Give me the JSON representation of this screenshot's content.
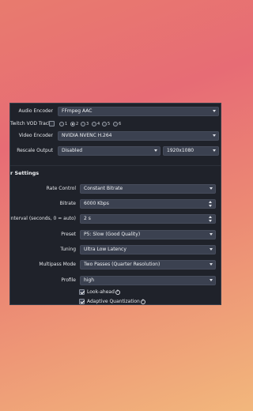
{
  "top_settings": {
    "audio_encoder": {
      "label": "Audio Encoder",
      "value": "FFmpeg AAC"
    },
    "twitch_vod_track": {
      "label": "Twitch VOD Track",
      "tracks": [
        "1",
        "2",
        "3",
        "4",
        "5",
        "6"
      ],
      "selected": "2"
    },
    "video_encoder": {
      "label": "Video Encoder",
      "value": "NVIDIA NVENC H.264"
    },
    "rescale_output": {
      "label": "Rescale Output",
      "value": "Disabled",
      "resolution": "1920x1080"
    }
  },
  "encoder_settings": {
    "section_title": "r Settings",
    "rate_control": {
      "label": "Rate Control",
      "value": "Constant Bitrate"
    },
    "bitrate": {
      "label": "Bitrate",
      "value": "6000 Kbps"
    },
    "keyframe_interval": {
      "label": "me Interval (seconds, 0 = auto)",
      "value": "2 s"
    },
    "preset": {
      "label": "Preset",
      "value": "P5: Slow (Good Quality)"
    },
    "tuning": {
      "label": "Tuning",
      "value": "Ultra Low Latency"
    },
    "multipass_mode": {
      "label": "Multipass Mode",
      "value": "Two Passes (Quarter Resolution)"
    },
    "profile": {
      "label": "Profile",
      "value": "high"
    },
    "look_ahead": {
      "label": "Look-ahead",
      "checked": true,
      "help": "?"
    },
    "adaptive_quantization": {
      "label": "Adaptive Quantization",
      "checked": true,
      "help": "?"
    }
  },
  "colors": {
    "panel_bg": "#1f222a",
    "control_bg": "#3b4150",
    "text": "#e4e6ea"
  }
}
